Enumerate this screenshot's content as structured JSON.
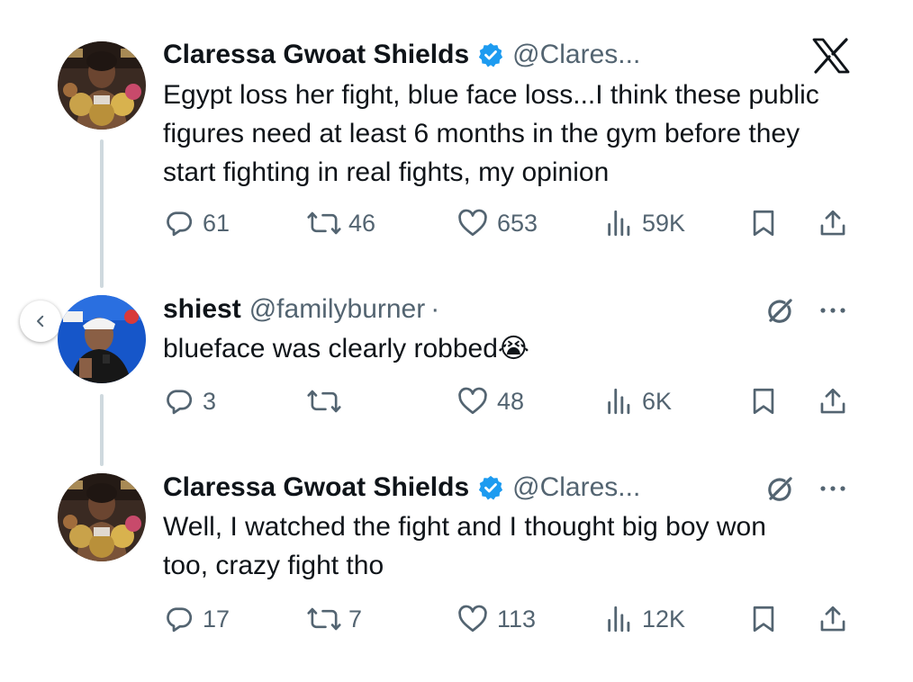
{
  "app": "X",
  "icons": {
    "reply": "reply-icon",
    "retweet": "retweet-icon",
    "like": "heart-icon",
    "views": "views-icon",
    "bookmark": "bookmark-icon",
    "share": "share-icon",
    "verified": "verified-badge-icon",
    "logo": "x-logo-icon",
    "grok": "grok-icon",
    "more": "more-icon",
    "back": "chevron-left-icon"
  },
  "colors": {
    "verified": "#1d9bf0",
    "muted": "#536471",
    "thread": "#cfd9de"
  },
  "tweets": [
    {
      "name": "Claressa Gwoat Shields",
      "handle": "@Clares...",
      "verified": true,
      "text": "Egypt loss her fight, blue face loss...I think these public figures need at least 6 months in the gym before they start fighting in real fights, my opinion",
      "stats": {
        "replies": "61",
        "retweets": "46",
        "likes": "653",
        "views": "59K"
      }
    },
    {
      "name": "shiest",
      "handle": "@familyburner",
      "separator": "·",
      "verified": false,
      "text": "blueface was clearly robbed",
      "emoji": "😭",
      "stats": {
        "replies": "3",
        "retweets": "",
        "likes": "48",
        "views": "6K"
      }
    },
    {
      "name": "Claressa Gwoat Shields",
      "handle": "@Clares...",
      "verified": true,
      "text": "Well, I watched the fight and I thought big boy won too, crazy fight tho",
      "stats": {
        "replies": "17",
        "retweets": "7",
        "likes": "113",
        "views": "12K"
      }
    }
  ]
}
